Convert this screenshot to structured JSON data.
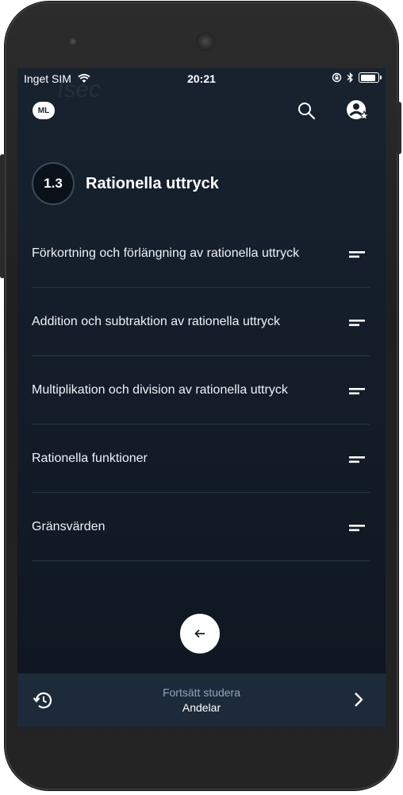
{
  "status_bar": {
    "carrier": "Inget SIM",
    "time": "20:21"
  },
  "watermark": "Isec",
  "top_bar": {
    "profile_badge": "ML"
  },
  "section": {
    "number": "1.3",
    "title": "Rationella uttryck"
  },
  "lessons": [
    {
      "label": "Förkortning och förlängning av rationella uttryck"
    },
    {
      "label": "Addition och subtraktion av rationella uttryck"
    },
    {
      "label": "Multiplikation och division av rationella uttryck"
    },
    {
      "label": "Rationella funktioner"
    },
    {
      "label": "Gränsvärden"
    }
  ],
  "continue_bar": {
    "label": "Fortsätt studera",
    "subtitle": "Andelar"
  },
  "colors": {
    "screen_bg": "#141d29",
    "bottom_bar": "#1d2a3a",
    "divider": "#2a3645"
  }
}
